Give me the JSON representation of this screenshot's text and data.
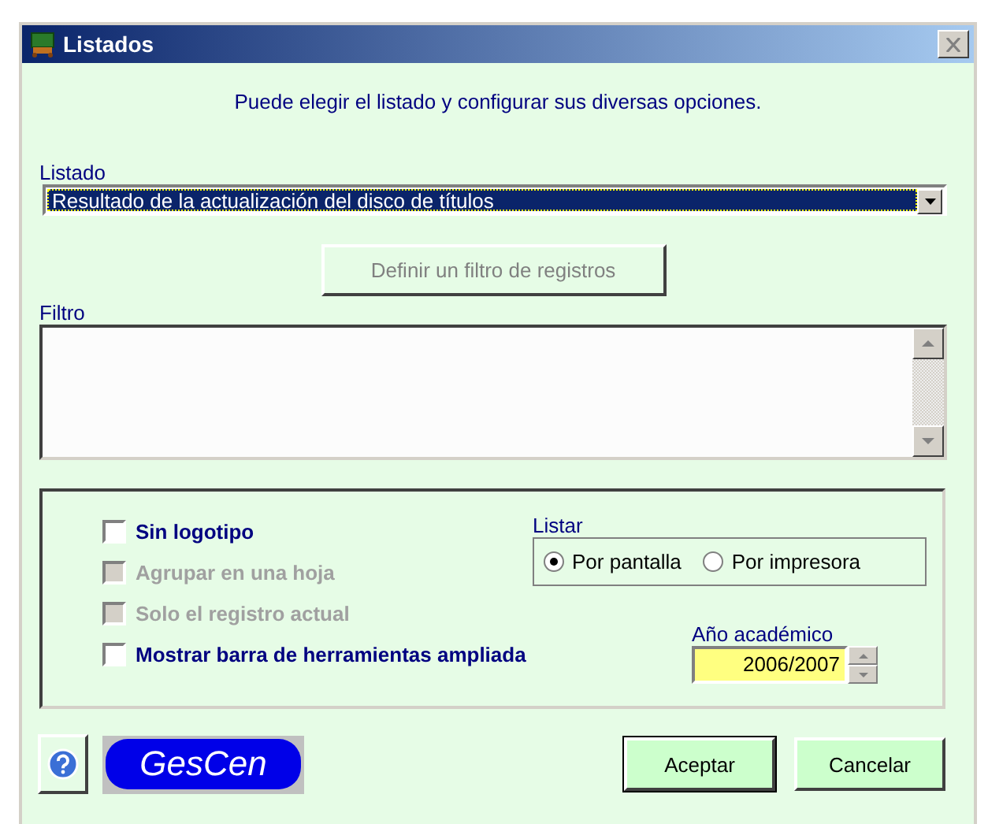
{
  "window": {
    "title": "Listados"
  },
  "intro": "Puede elegir el listado y configurar sus diversas opciones.",
  "listado": {
    "label": "Listado",
    "value": "Resultado de la actualización del disco de títulos"
  },
  "filter_button": {
    "label": "Definir un filtro de registros",
    "disabled": true
  },
  "filtro": {
    "label": "Filtro"
  },
  "options": {
    "checkboxes": [
      {
        "label": "Sin logotipo",
        "checked": false,
        "disabled": false
      },
      {
        "label": "Agrupar en una hoja",
        "checked": false,
        "disabled": true
      },
      {
        "label": "Solo el registro actual",
        "checked": false,
        "disabled": true
      },
      {
        "label": "Mostrar barra de herramientas ampliada",
        "checked": false,
        "disabled": false
      }
    ],
    "listar": {
      "label": "Listar",
      "options": [
        {
          "label": "Por pantalla",
          "selected": true
        },
        {
          "label": "Por impresora",
          "selected": false
        }
      ]
    },
    "academic_year": {
      "label": "Año académico",
      "value": "2006/2007"
    }
  },
  "logo": "GesCen",
  "buttons": [
    {
      "label": "Aceptar",
      "default": true
    },
    {
      "label": "Cancelar",
      "default": false
    }
  ]
}
